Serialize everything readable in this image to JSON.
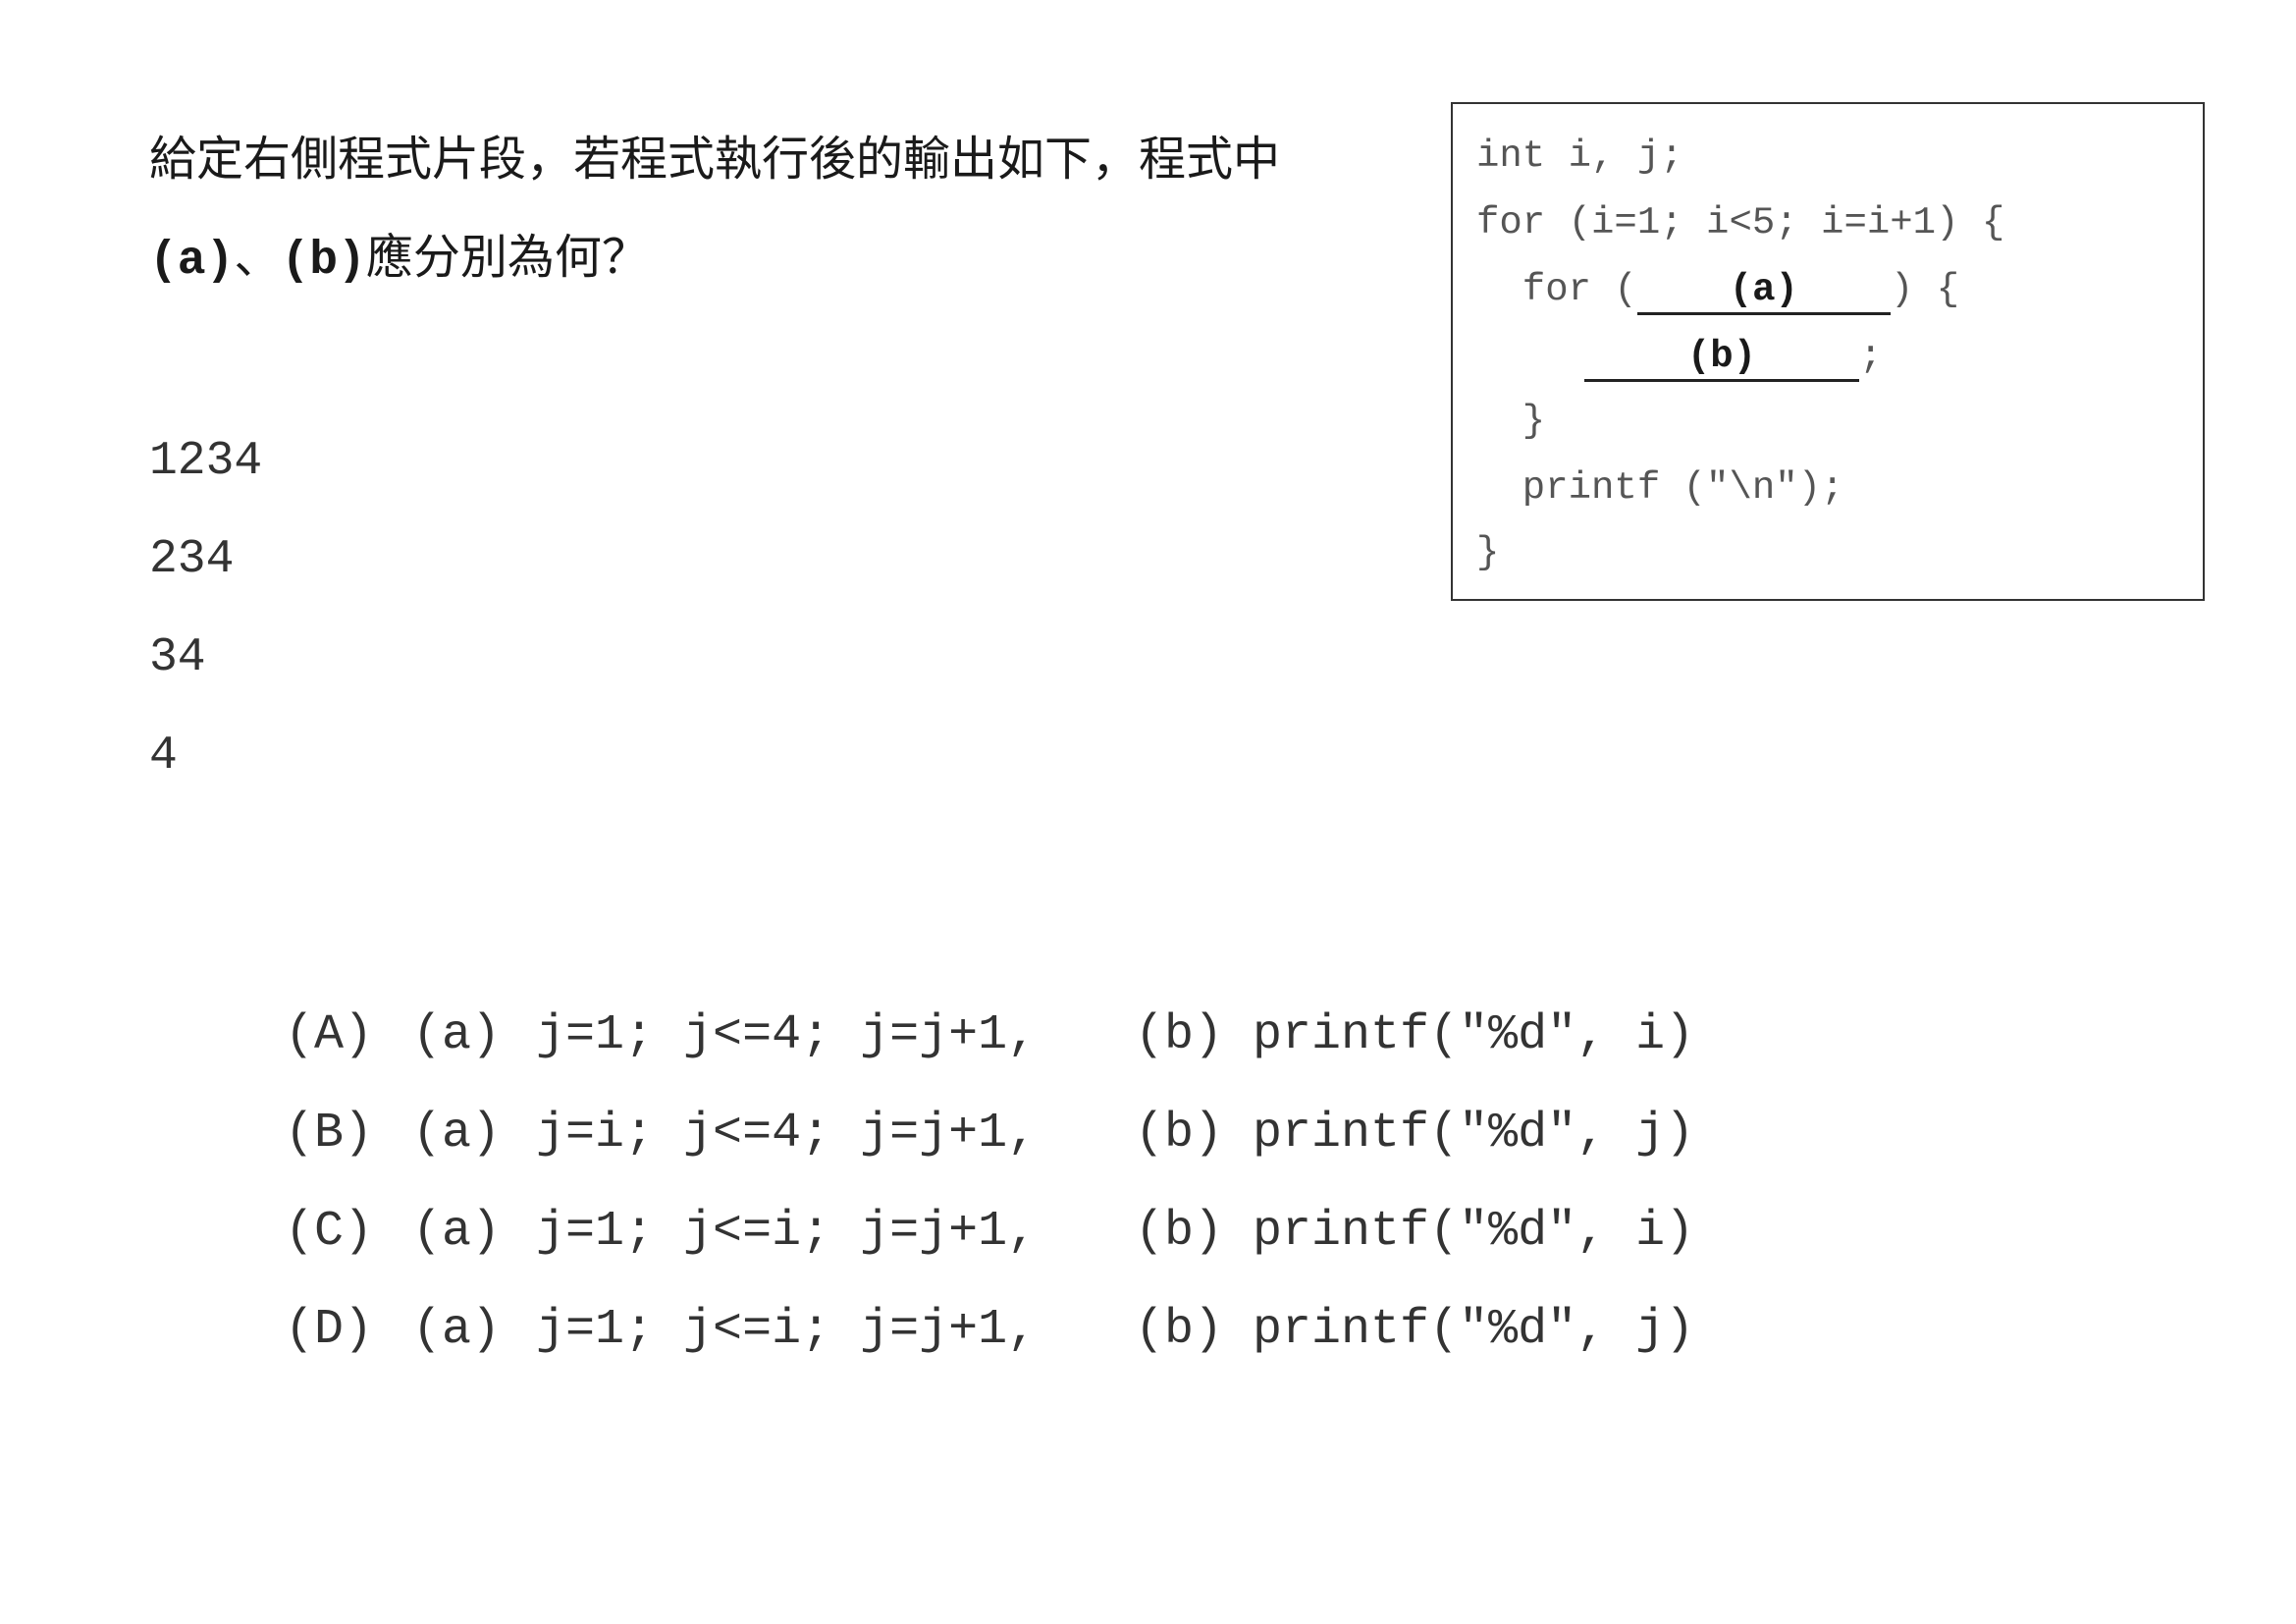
{
  "question": {
    "line1": "給定右側程式片段，若程式執行後的輸出如下，程式中",
    "label_a": "(a)",
    "separator": "、",
    "label_b": "(b)",
    "line2_tail": "應分別為何？"
  },
  "output_lines": [
    "1234",
    "234",
    "34",
    "4"
  ],
  "code": {
    "line1": "int i, j;",
    "line2": "for (i=1; i<5; i=i+1) {",
    "line3_pre": "  for (",
    "blank_a": "(a)",
    "line3_post": ") {",
    "blank_b": "(b)",
    "line4_post": ";",
    "line5": "  }",
    "line6": "  printf (\"\\n\");",
    "line7": "}"
  },
  "options": [
    {
      "letter": "(A)",
      "a_label": "(a)",
      "a_value": "j=1; j<=4; j=j+1,",
      "b_label": "(b)",
      "b_value": "printf(\"%d\", i)"
    },
    {
      "letter": "(B)",
      "a_label": "(a)",
      "a_value": "j=i; j<=4; j=j+1,",
      "b_label": "(b)",
      "b_value": "printf(\"%d\", j)"
    },
    {
      "letter": "(C)",
      "a_label": "(a)",
      "a_value": "j=1; j<=i; j=j+1,",
      "b_label": "(b)",
      "b_value": "printf(\"%d\", i)"
    },
    {
      "letter": "(D)",
      "a_label": "(a)",
      "a_value": "j=1; j<=i; j=j+1,",
      "b_label": "(b)",
      "b_value": "printf(\"%d\", j)"
    }
  ]
}
